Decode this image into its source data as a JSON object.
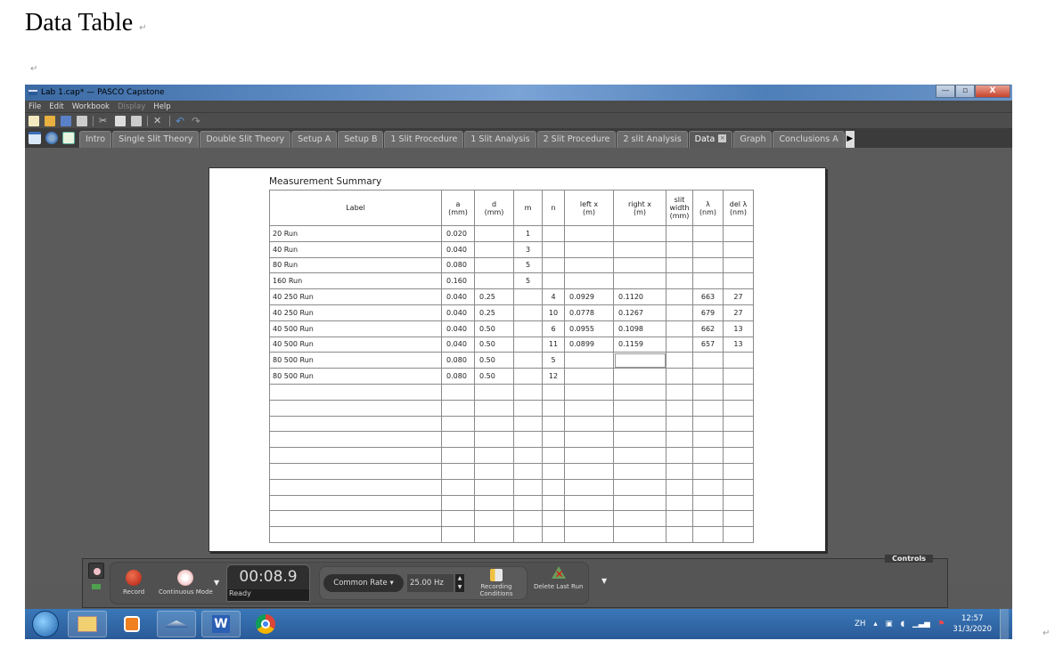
{
  "document": {
    "heading": "Data Table",
    "para_mark": "↵"
  },
  "window": {
    "title": "Lab 1.cap* — PASCO Capstone",
    "controls": {
      "minimize": "—",
      "maximize": "▫",
      "close": "X"
    }
  },
  "menu": [
    "File",
    "Edit",
    "Workbook",
    "Display",
    "Help"
  ],
  "toolbar": {
    "icons": [
      "new-file-icon",
      "open-folder-icon",
      "save-icon",
      "print-icon",
      "cut-icon",
      "copy-icon",
      "paste-icon",
      "delete-icon",
      "undo-icon",
      "redo-icon"
    ]
  },
  "tabs": [
    {
      "label": "Intro"
    },
    {
      "label": "Single Slit Theory"
    },
    {
      "label": "Double Slit Theory"
    },
    {
      "label": "Setup A"
    },
    {
      "label": "Setup B"
    },
    {
      "label": "1 Slit Procedure"
    },
    {
      "label": "1 Slit Analysis"
    },
    {
      "label": "2 Slit Procedure"
    },
    {
      "label": "2 slit Analysis"
    },
    {
      "label": "Data",
      "active": true,
      "close": "×"
    },
    {
      "label": "Graph"
    },
    {
      "label": "Conclusions A"
    }
  ],
  "tab_scroll": "▶",
  "table": {
    "title": "Measurement Summary",
    "headers": [
      [
        "Label"
      ],
      [
        "a",
        "(mm)"
      ],
      [
        "d",
        "(mm)"
      ],
      [
        "m"
      ],
      [
        "n"
      ],
      [
        "left x",
        "(m)"
      ],
      [
        "right x",
        "(m)"
      ],
      [
        "slit",
        "width",
        "(mm)"
      ],
      [
        "λ",
        "(nm)"
      ],
      [
        "del λ",
        "(nm)"
      ]
    ],
    "rows": [
      [
        "20 Run",
        "0.020",
        "",
        "1",
        "",
        "",
        "",
        "",
        "",
        ""
      ],
      [
        "40 Run",
        "0.040",
        "",
        "3",
        "",
        "",
        "",
        "",
        "",
        ""
      ],
      [
        "80 Run",
        "0.080",
        "",
        "5",
        "",
        "",
        "",
        "",
        "",
        ""
      ],
      [
        "160 Run",
        "0.160",
        "",
        "5",
        "",
        "",
        "",
        "",
        "",
        ""
      ],
      [
        "40 250 Run",
        "0.040",
        "0.25",
        "",
        "4",
        "0.0929",
        "0.1120",
        "",
        "663",
        "27"
      ],
      [
        "40 250 Run",
        "0.040",
        "0.25",
        "",
        "10",
        "0.0778",
        "0.1267",
        "",
        "679",
        "27"
      ],
      [
        "40 500 Run",
        "0.040",
        "0.50",
        "",
        "6",
        "0.0955",
        "0.1098",
        "",
        "662",
        "13"
      ],
      [
        "40 500 Run",
        "0.040",
        "0.50",
        "",
        "11",
        "0.0899",
        "0.1159",
        "",
        "657",
        "13"
      ],
      [
        "80 500 Run",
        "0.080",
        "0.50",
        "",
        "5",
        "",
        "",
        "",
        "",
        ""
      ],
      [
        "80 500 Run",
        "0.080",
        "0.50",
        "",
        "12",
        "",
        "",
        "",
        "",
        ""
      ]
    ],
    "empty_rows": 10
  },
  "controls": {
    "panel_label": "Controls",
    "record_label": "Record",
    "mode_label": "Continuous Mode",
    "timer": "00:08.9",
    "status": "Ready",
    "rate_label": "Common Rate ▾",
    "rate_value": "25.00 Hz",
    "recording_conditions_label": "Recording Conditions",
    "delete_last_run_label": "Delete Last Run"
  },
  "taskbar": {
    "apps": [
      "windows-explorer",
      "media-player",
      "pasco-capstone",
      "microsoft-word",
      "google-chrome"
    ],
    "language": "ZH",
    "time": "12:57",
    "date": "31/3/2020"
  }
}
